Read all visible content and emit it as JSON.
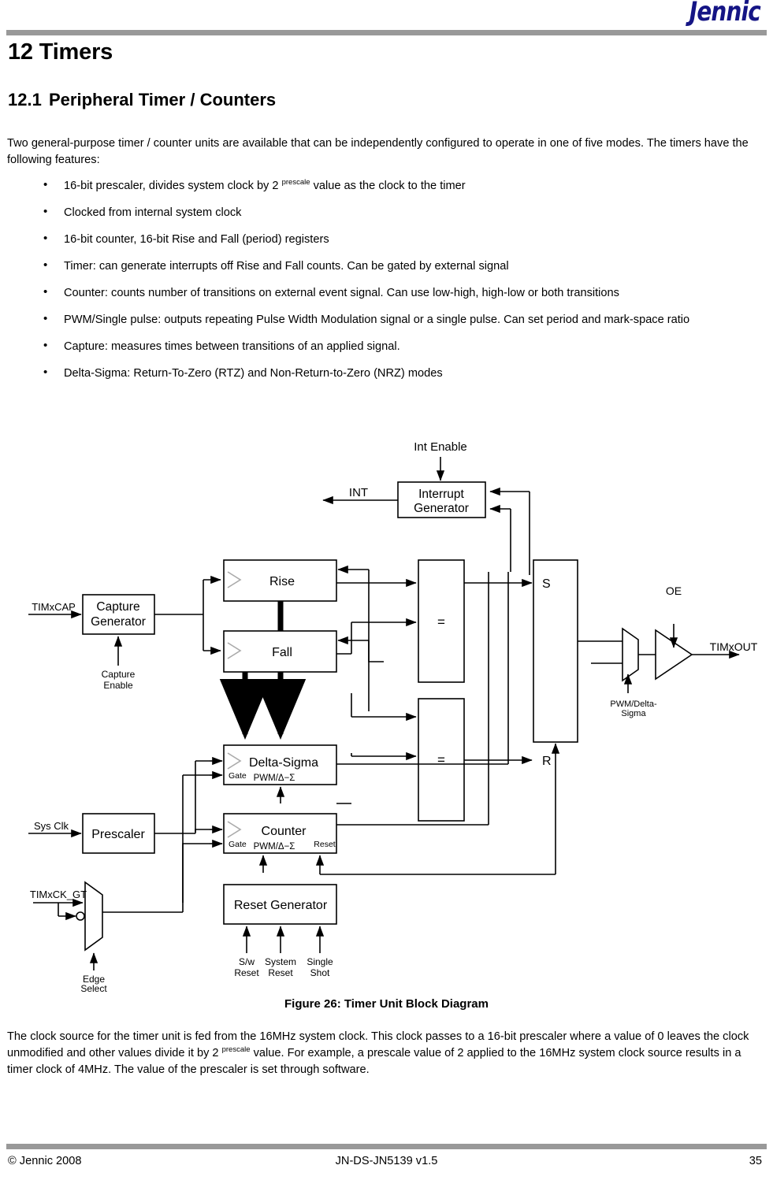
{
  "header": {
    "logo_text": "Jennic",
    "logo_color": "#151585",
    "rule_color": "#999999"
  },
  "chapter": {
    "heading": "12 Timers",
    "section_number": "12.1",
    "section_title": "Peripheral Timer / Counters"
  },
  "intro_paragraph": "Two general-purpose timer / counter units are available that can be independently configured to operate in one of five modes.  The timers have the following features:",
  "bullets": [
    {
      "pre": "16-bit prescaler, divides system clock by 2 ",
      "sup": "prescale",
      "post": " value as the clock to the timer"
    },
    {
      "pre": "Clocked from internal system clock",
      "sup": "",
      "post": ""
    },
    {
      "pre": "16-bit counter, 16-bit Rise and Fall (period) registers",
      "sup": "",
      "post": ""
    },
    {
      "pre": "Timer: can generate interrupts off Rise and Fall counts.  Can be gated by external signal",
      "sup": "",
      "post": ""
    },
    {
      "pre": "Counter: counts number of transitions on external event signal.  Can use low-high, high-low or both transitions",
      "sup": "",
      "post": ""
    },
    {
      "pre": "PWM/Single pulse: outputs repeating Pulse Width Modulation signal or a single pulse.  Can set period and mark-space ratio",
      "sup": "",
      "post": ""
    },
    {
      "pre": "Capture: measures times between transitions of an applied signal.",
      "sup": "",
      "post": ""
    },
    {
      "pre": "Delta-Sigma: Return-To-Zero (RTZ) and Non-Return-to-Zero (NRZ) modes",
      "sup": "",
      "post": ""
    }
  ],
  "figure": {
    "caption": "Figure 26: Timer Unit Block Diagram",
    "blocks": {
      "interrupt_generator_line1": "Interrupt",
      "interrupt_generator_line2": "Generator",
      "capture_generator_line1": "Capture",
      "capture_generator_line2": "Generator",
      "rise": "Rise",
      "fall": "Fall",
      "delta_sigma": "Delta-Sigma",
      "delta_sigma_sub": "PWM/Δ−Σ",
      "counter": "Counter",
      "counter_sub": "PWM/Δ−Σ",
      "prescaler": "Prescaler",
      "reset_generator": "Reset Generator",
      "comparator_top": "=",
      "comparator_bottom": "=",
      "latch_set": "S",
      "latch_reset": "R"
    },
    "signals": {
      "int_enable": "Int Enable",
      "int": "INT",
      "timxcap": "TIMxCAP",
      "capture_enable_line1": "Capture",
      "capture_enable_line2": "Enable",
      "sys_clk": "Sys Clk",
      "timxck_gt": "TIMxCK_GT",
      "edge_select_line1": "Edge",
      "edge_select_line2": "Select",
      "sw_reset_line1": "S/w",
      "sw_reset_line2": "Reset",
      "system_reset_line1": "System",
      "system_reset_line2": "Reset",
      "single_shot_line1": "Single",
      "single_shot_line2": "Shot",
      "oe": "OE",
      "timxout": "TIMxOUT",
      "pwm_delta_line1": "PWM/Delta-",
      "pwm_delta_line2": "Sigma",
      "gate_delta": "Gate",
      "gate_counter": "Gate",
      "reset_port": "Reset"
    }
  },
  "closing_paragraph": "The clock source for the timer unit is fed from the 16MHz system clock. This clock passes to a 16-bit prescaler where a value of 0 leaves the clock unmodified and other values divide it by 2 ",
  "closing_sup": "prescale",
  "closing_paragraph_2": " value.  For example, a prescale value of 2 applied to the 16MHz system clock source results in a timer clock of 4MHz.  The value of the prescaler is set through software.",
  "footer": {
    "copyright": "© Jennic 2008",
    "doc_id": "JN-DS-JN5139 v1.5",
    "page_number": "35"
  }
}
